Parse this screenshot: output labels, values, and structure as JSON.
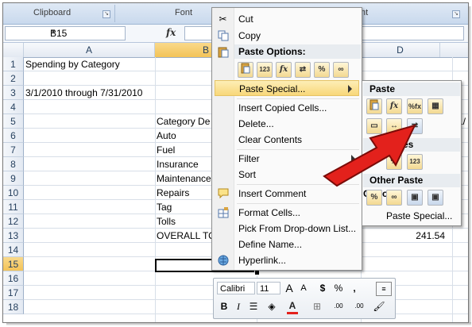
{
  "ribbon": {
    "groups": [
      "Clipboard",
      "Font",
      "nt"
    ]
  },
  "formula_bar": {
    "name_box": "B15",
    "fx": "fx",
    "formula": ""
  },
  "columns": [
    "A",
    "B",
    "D"
  ],
  "rows": [
    "1",
    "2",
    "3",
    "4",
    "5",
    "6",
    "7",
    "8",
    "9",
    "10",
    "11",
    "12",
    "13",
    "14",
    "15",
    "16",
    "17",
    "18"
  ],
  "cells": {
    "a1": "Spending by Category",
    "a3": "3/1/2010 through 7/31/2010",
    "b5": "Category De",
    "b6": "Auto",
    "b7": "Fuel",
    "b8": "Insurance",
    "b9": "Maintenance",
    "b10": "Repairs",
    "b11": "Tag",
    "b12": "Tolls",
    "b13": "OVERALL TO",
    "d12": "4",
    "d13": "241.54",
    "e5": "1/"
  },
  "context_menu": {
    "cut": "Cut",
    "copy": "Copy",
    "paste_options": "Paste Options:",
    "paste_special": "Paste Special...",
    "insert_copied": "Insert Copied Cells...",
    "delete": "Delete...",
    "clear_contents": "Clear Contents",
    "filter": "Filter",
    "sort": "Sort",
    "insert_comment": "Insert Comment",
    "format_cells": "Format Cells...",
    "pick_dropdown": "Pick From Drop-down List...",
    "define_name": "Define Name...",
    "hyperlink": "Hyperlink...",
    "paste_buttons": [
      "paste",
      "123",
      "fx",
      "format",
      "%",
      "link"
    ]
  },
  "submenu": {
    "paste": "Paste",
    "values": "es",
    "other": "Other Paste Options",
    "paste_special": "Paste Special..."
  },
  "mini_toolbar": {
    "font": "Calibri",
    "size": "11",
    "grow": "A",
    "shrink": "A",
    "currency": "$",
    "percent": "%",
    "comma": ",",
    "bold": "B",
    "italic": "I",
    "font_color_letter": "A",
    "inc_decimal": ".00",
    "dec_decimal": ".00"
  },
  "colors": {
    "accent_red": "#e3211c",
    "highlight": "#f8d779",
    "ribbon": "#c9d9ed"
  }
}
